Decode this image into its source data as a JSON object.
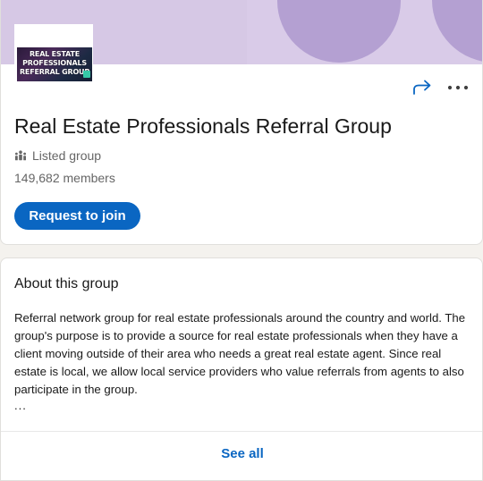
{
  "colors": {
    "accent": "#0a66c2",
    "banner": "#d9cbe8",
    "banner_shape": "#b4a0d2",
    "text_primary": "#191919",
    "text_secondary": "#666666"
  },
  "group": {
    "logo_lines": [
      "REAL ESTATE",
      "PROFESSIONALS",
      "REFERRAL GROUP"
    ],
    "name": "Real Estate Professionals Referral Group",
    "visibility_label": "Listed group",
    "visibility_icon": "group-icon",
    "members": "149,682 members",
    "join_button": "Request to join"
  },
  "actions": {
    "share_icon": "share-arrow-icon",
    "more_icon": "more-horizontal-icon"
  },
  "about": {
    "title": "About this group",
    "description": "Referral network group for real estate professionals around the country and world. The group's purpose is to provide a source for real estate professionals when they have a client moving outside of their area who needs a great real estate agent. Since real estate is local, we allow local service providers who value referrals from agents to also participate in the group.",
    "ellipsis": "...",
    "see_all": "See all"
  }
}
